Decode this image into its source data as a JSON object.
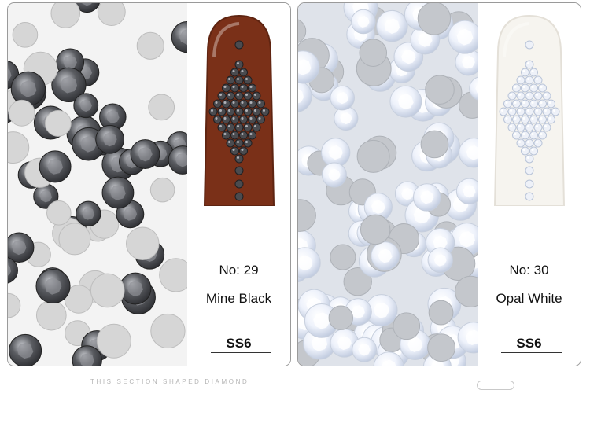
{
  "products": [
    {
      "number_label": "No: 29",
      "color_name": "Mine Black",
      "size_label": "SS6",
      "stone_color": "#4a4b4f",
      "nail_color": "#7a3018"
    },
    {
      "number_label": "No: 30",
      "color_name": "Opal White",
      "size_label": "SS6",
      "stone_color": "#eef1f8",
      "nail_color": "#f6f4ef"
    }
  ],
  "footer": {
    "caption": "THIS SECTION SHAPED DIAMOND"
  }
}
